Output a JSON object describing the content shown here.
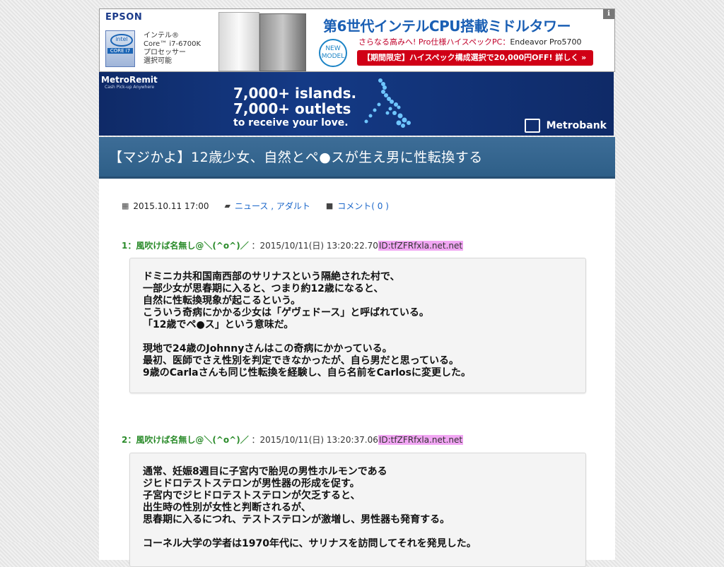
{
  "ads": {
    "epson": {
      "logo": "EPSON",
      "info": "i",
      "intel_text": "インテル®\nCore™ i7-6700K\nプロセッサー\n選択可能",
      "intel_badge": "intel",
      "intel_core": "CORE i7",
      "new_model": "NEW\nMODEL",
      "headline": "第6世代インテルCPU搭載ミドルタワー",
      "sub": "さらなる高みへ! Pro仕様ハイスペックPC：",
      "sub_model": "Endeavor Pro5700",
      "cta": "【期間限定】ハイスペック構成選択で20,000円OFF! 詳しく »"
    },
    "metro": {
      "brand": "MetroRemit",
      "tag": "Cash Pick-up Anywhere",
      "line1": "7,000+ islands.",
      "line2": "7,000+ outlets",
      "line3": "to receive your love.",
      "bank": "Metrobank"
    }
  },
  "article": {
    "title": "【マジかよ】12歳少女、自然とペ●スが生え男に性転換する",
    "date": "2015.10.11 17:00",
    "categories": "ニュース , アダルト",
    "comments": "コメント( 0 )"
  },
  "responses": [
    {
      "num": "1",
      "name": "風吹けば名無し@＼(^o^)／",
      "date": "：2015/10/11(日) 13:20:22.70",
      "id": "ID:tfZFRfxla.net.net",
      "lines": [
        "ドミニカ共和国南西部のサリナスという隔絶された村で、",
        "一部少女が思春期に入ると、つまり約12歳になると、",
        "自然に性転換現象が起こるという。",
        "こういう奇病にかかる少女は「ゲヴェドース」と呼ばれている。",
        "「12歳でペ●ス」という意味だ。",
        "",
        "現地で24歳のJohnnyさんはこの奇病にかかっている。",
        "最初、医師でさえ性別を判定できなかったが、自ら男だと思っている。",
        "9歳のCarlaさんも同じ性転換を経験し、自ら名前をCarlosに変更した。"
      ]
    },
    {
      "num": "2",
      "name": "風吹けば名無し@＼(^o^)／",
      "date": "：2015/10/11(日) 13:20:37.06",
      "id": "ID:tfZFRfxla.net.net",
      "lines": [
        "通常、妊娠8週目に子宮内で胎児の男性ホルモンである",
        "ジヒドロテストステロンが男性器の形成を促す。",
        "子宮内でジヒドロテストステロンが欠乏すると、",
        "出生時の性別が女性と判断されるが、",
        "思春期に入るにつれ、テストステロンが激増し、男性器も発育する。",
        "",
        "コーネル大学の学者は1970年代に、サリナスを訪問してそれを発見した。"
      ]
    }
  ]
}
